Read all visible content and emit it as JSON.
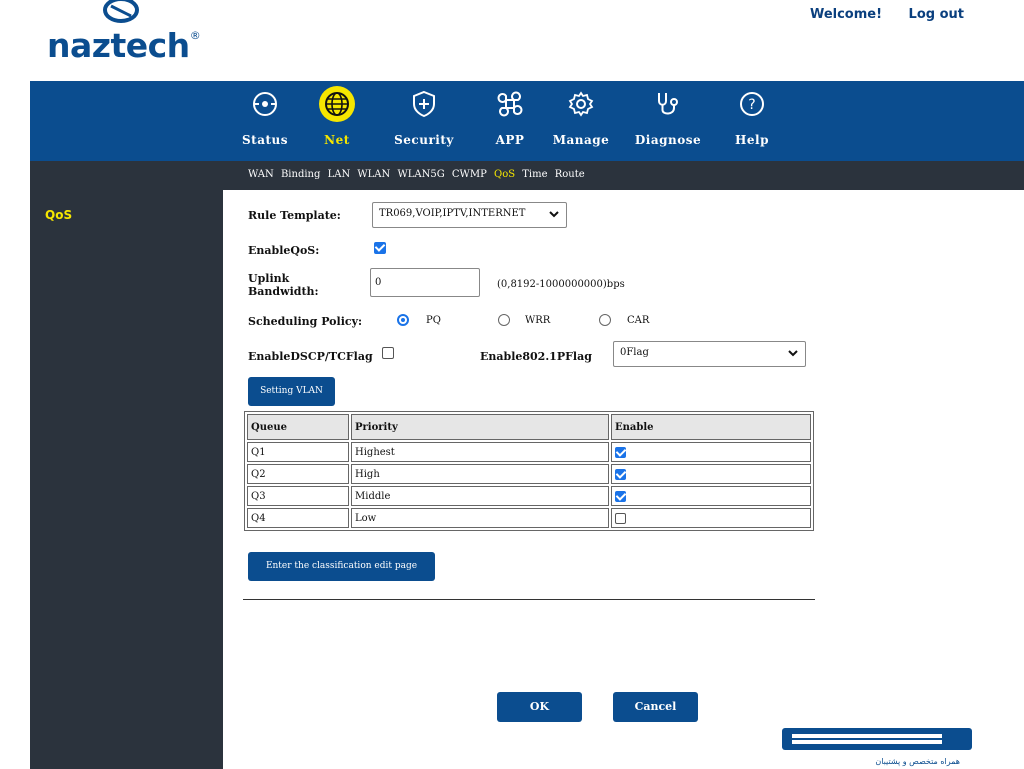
{
  "header": {
    "logo_text": "naztech",
    "welcome": "Welcome!",
    "logout": "Log out"
  },
  "nav": {
    "items": [
      {
        "label": "Status",
        "icon": "crosshair-circle-icon"
      },
      {
        "label": "Net",
        "icon": "globe-icon",
        "active": true
      },
      {
        "label": "Security",
        "icon": "shield-plus-icon"
      },
      {
        "label": "APP",
        "icon": "command-key-icon"
      },
      {
        "label": "Manage",
        "icon": "gear-icon"
      },
      {
        "label": "Diagnose",
        "icon": "stethoscope-icon"
      },
      {
        "label": "Help",
        "icon": "question-circle-icon"
      }
    ]
  },
  "subnav": {
    "items": [
      "WAN",
      "Binding",
      "LAN",
      "WLAN",
      "WLAN5G",
      "CWMP",
      "QoS",
      "Time",
      "Route"
    ],
    "active": "QoS"
  },
  "sidebar": {
    "items": [
      "QoS"
    ]
  },
  "form": {
    "rule_template_label": "Rule Template:",
    "rule_template_value": "TR069,VOIP,IPTV,INTERNET",
    "enable_qos_label": "EnableQoS:",
    "enable_qos": true,
    "uplink_label_1": "Uplink",
    "uplink_label_2": "Bandwidth:",
    "uplink_value": "0",
    "uplink_hint": "(0,8192-1000000000)bps",
    "sched_label": "Scheduling Policy:",
    "sched_options": [
      "PQ",
      "WRR",
      "CAR"
    ],
    "sched_selected": "PQ",
    "dscp_label": "EnableDSCP/TCFlag",
    "dscp_checked": false,
    "p8021_label": "Enable802.1PFlag",
    "p8021_value": "0Flag",
    "setting_vlan_btn": "Setting VLAN",
    "classification_btn": "Enter the classification edit page",
    "ok_btn": "OK",
    "cancel_btn": "Cancel"
  },
  "table": {
    "headers": [
      "Queue",
      "Priority",
      "Enable"
    ],
    "rows": [
      {
        "queue": "Q1",
        "priority": "Highest",
        "enable": true
      },
      {
        "queue": "Q2",
        "priority": "High",
        "enable": true
      },
      {
        "queue": "Q3",
        "priority": "Middle",
        "enable": true
      },
      {
        "queue": "Q4",
        "priority": "Low",
        "enable": false
      }
    ]
  },
  "footer_brand": {
    "tagline": "همراه متخصص و پشتیبان"
  },
  "colors": {
    "primary": "#0b4d8f",
    "dark": "#2b333d",
    "accent": "#f5e600",
    "checkbox": "#1a73e8"
  }
}
